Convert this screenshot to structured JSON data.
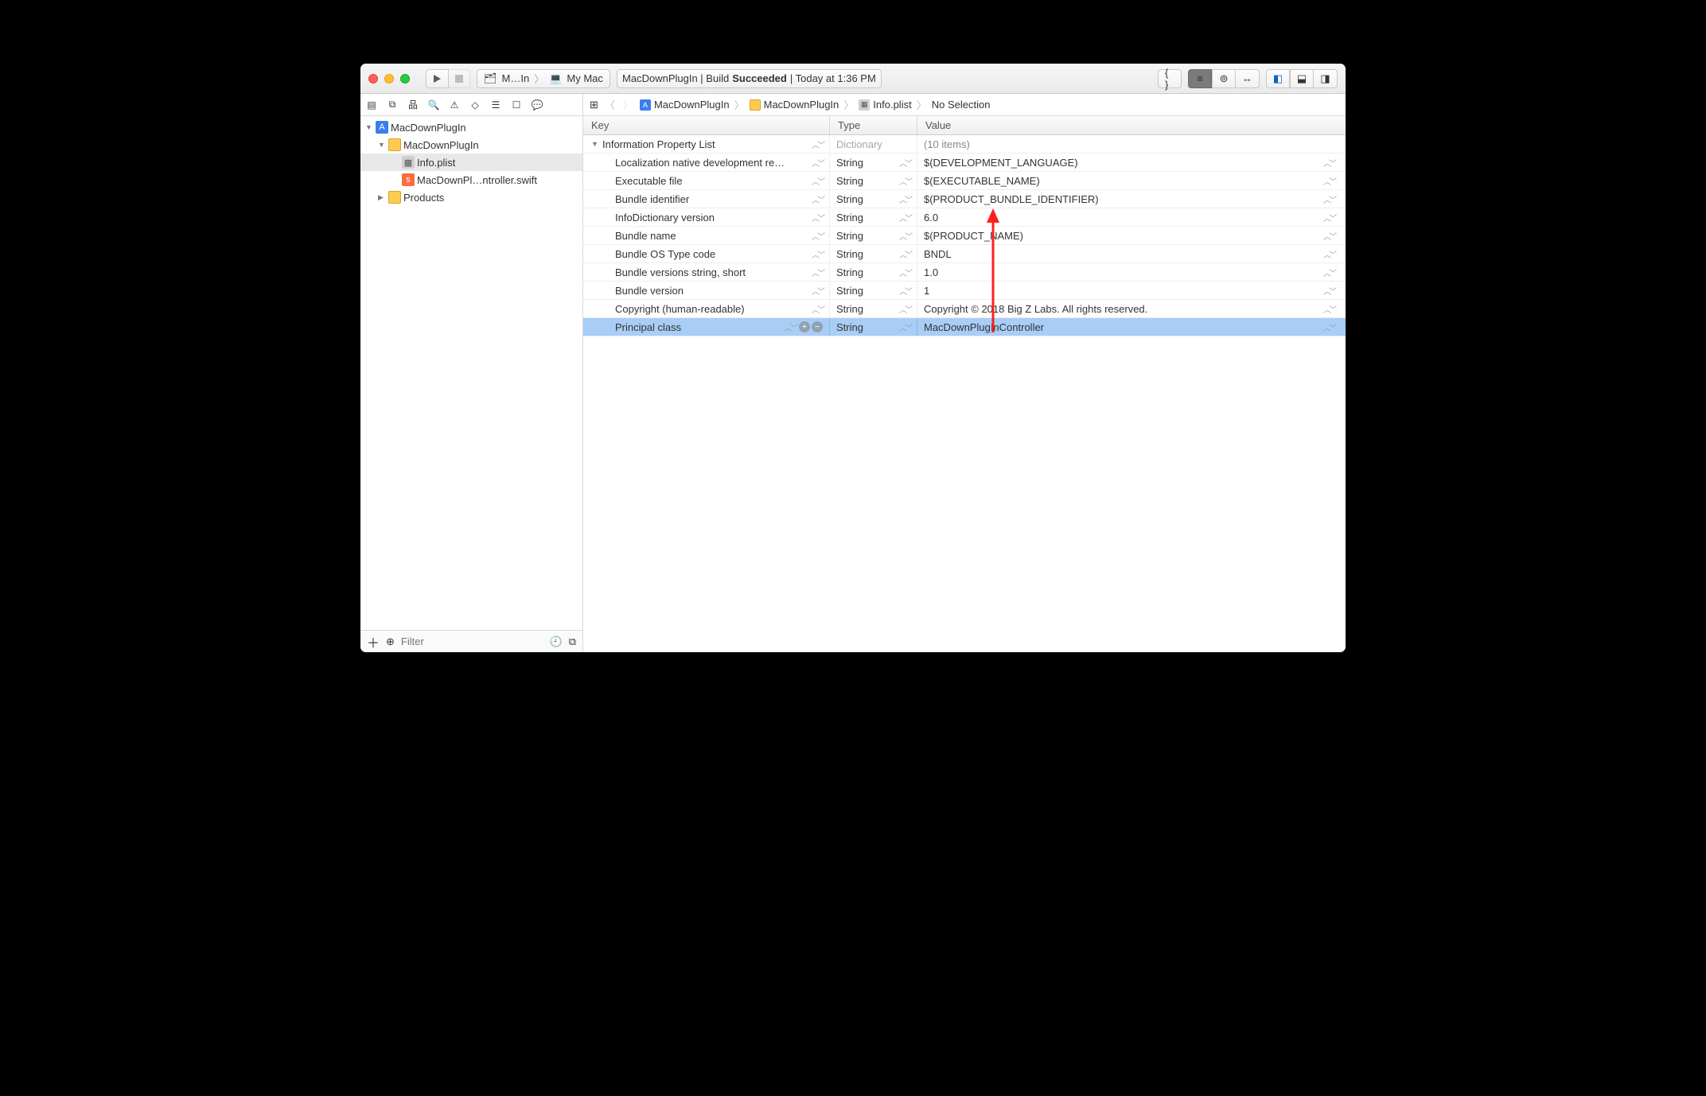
{
  "toolbar": {
    "scheme_project": "M…In",
    "scheme_dest": "My Mac",
    "activity_prefix": "MacDownPlugIn | Build ",
    "activity_status": "Succeeded",
    "activity_suffix": " | Today at 1:36 PM"
  },
  "navigator": {
    "filter_placeholder": "Filter",
    "tree": {
      "project": "MacDownPlugIn",
      "group": "MacDownPlugIn",
      "file_plist": "Info.plist",
      "file_swift": "MacDownPl…ntroller.swift",
      "products": "Products"
    }
  },
  "jumpbar": {
    "seg1": "MacDownPlugIn",
    "seg2": "MacDownPlugIn",
    "seg3": "Info.plist",
    "seg4": "No Selection"
  },
  "plist": {
    "columns": {
      "key": "Key",
      "type": "Type",
      "value": "Value"
    },
    "root": {
      "key": "Information Property List",
      "type": "Dictionary",
      "value": "(10 items)"
    },
    "rows": [
      {
        "key": "Localization native development re…",
        "type": "String",
        "value": "$(DEVELOPMENT_LANGUAGE)"
      },
      {
        "key": "Executable file",
        "type": "String",
        "value": "$(EXECUTABLE_NAME)"
      },
      {
        "key": "Bundle identifier",
        "type": "String",
        "value": "$(PRODUCT_BUNDLE_IDENTIFIER)"
      },
      {
        "key": "InfoDictionary version",
        "type": "String",
        "value": "6.0"
      },
      {
        "key": "Bundle name",
        "type": "String",
        "value": "$(PRODUCT_NAME)"
      },
      {
        "key": "Bundle OS Type code",
        "type": "String",
        "value": "BNDL"
      },
      {
        "key": "Bundle versions string, short",
        "type": "String",
        "value": "1.0"
      },
      {
        "key": "Bundle version",
        "type": "String",
        "value": "1"
      },
      {
        "key": "Copyright (human-readable)",
        "type": "String",
        "value": "Copyright © 2018 Big Z Labs. All rights reserved."
      },
      {
        "key": "Principal class",
        "type": "String",
        "value": "MacDownPlugInController",
        "selected": true
      }
    ]
  }
}
